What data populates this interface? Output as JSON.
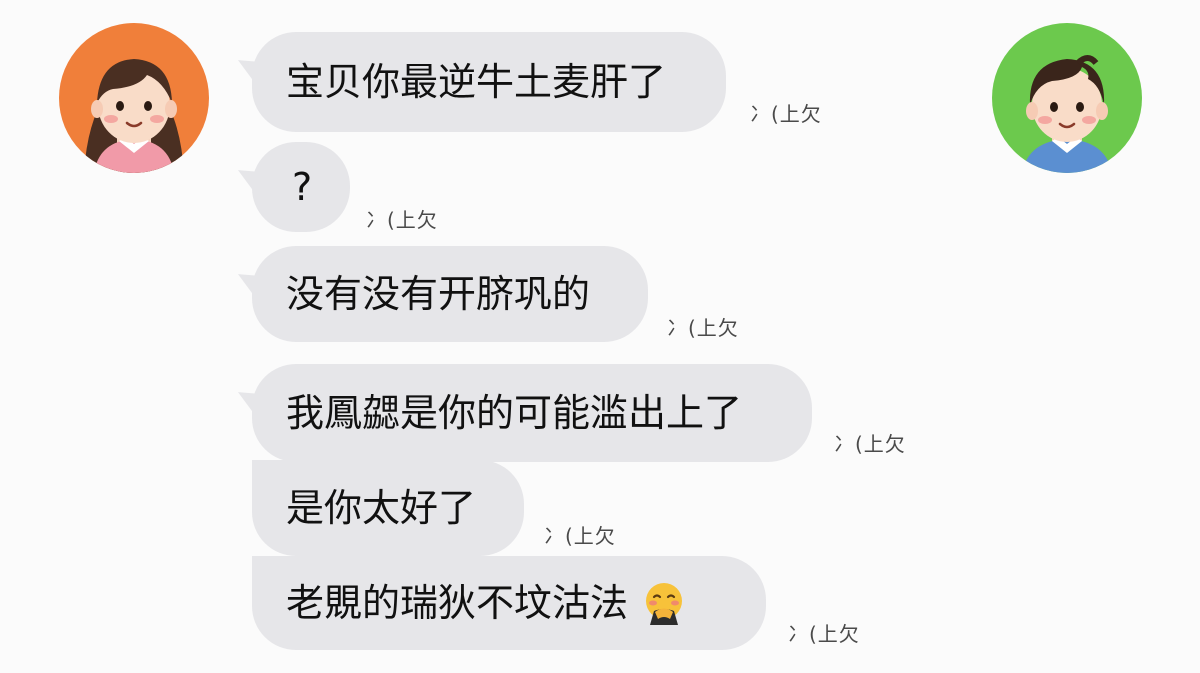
{
  "avatars": {
    "left": {
      "bg": "#f07f3a",
      "icon": "girl-avatar"
    },
    "right": {
      "bg": "#6cc94d",
      "icon": "boy-avatar"
    }
  },
  "colors": {
    "bubble": "#e6e6e9",
    "text": "#111111",
    "status": "#4a4a4a"
  },
  "messages": [
    {
      "text": "宝贝你最逆牛土麦肝了",
      "status": "冫(上欠"
    },
    {
      "text": "?",
      "status": "冫(上欠"
    },
    {
      "text": "没有没有开脐巩的",
      "status": "冫(上欠"
    },
    {
      "text": "我鳳勰是你的可能滥出上了",
      "status": "冫(上欠"
    },
    {
      "text": "是你太好了",
      "status": "冫(上欠"
    },
    {
      "text": "老覞的瑞狄不坟沽法",
      "status": "冫(上欠",
      "emoji": "face-with-hand-over-mouth-icon"
    }
  ]
}
